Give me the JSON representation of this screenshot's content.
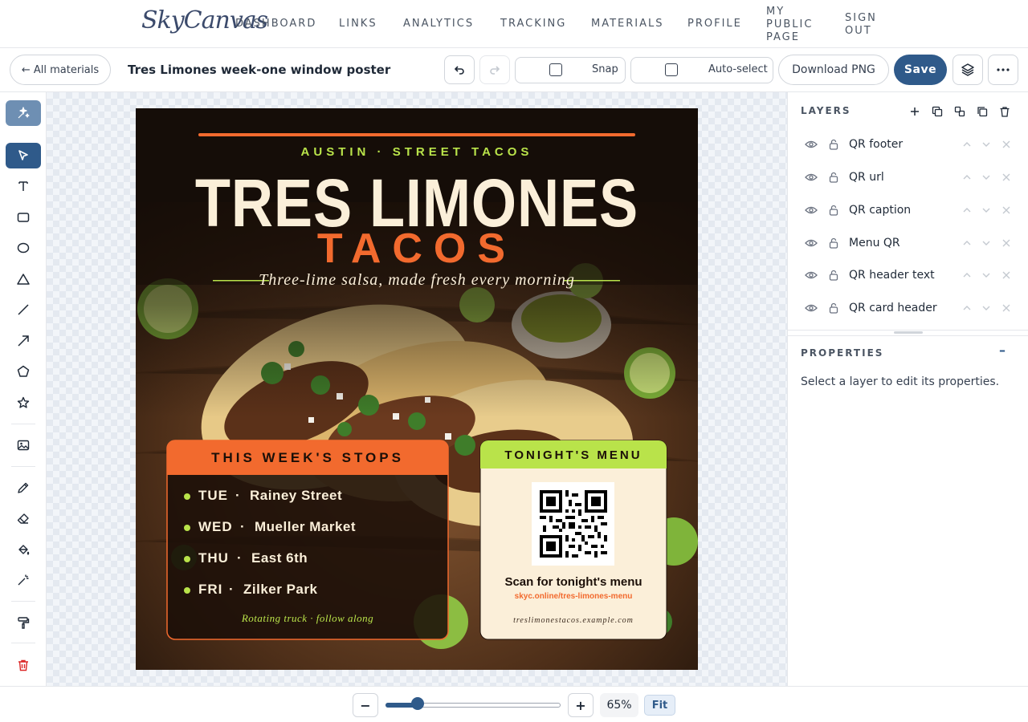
{
  "app": {
    "logo": "SkyCanvas"
  },
  "nav": {
    "dashboard": "DASHBOARD",
    "links": "LINKS",
    "analytics": "ANALYTICS",
    "tracking": "TRACKING",
    "materials": "MATERIALS",
    "profile": "PROFILE",
    "public_1": "MY",
    "public_2": "PUBLIC",
    "public_3": "PAGE",
    "sign_1": "SIGN",
    "sign_2": "OUT"
  },
  "toolbar": {
    "back": "← All materials",
    "title": "Tres Limones week-one window poster",
    "snap": "Snap",
    "autoselect": "Auto-select",
    "download": "Download PNG",
    "save": "Save"
  },
  "poster": {
    "kicker": "AUSTIN · STREET TACOS",
    "title": "TRES LIMONES",
    "subtitle": "TACOS",
    "tagline": "Three-lime salsa, made fresh every morning",
    "stops_header": "THIS WEEK'S STOPS",
    "stops": [
      {
        "day": "TUE",
        "place": "Rainey Street"
      },
      {
        "day": "WED",
        "place": "Mueller Market"
      },
      {
        "day": "THU",
        "place": "East 6th"
      },
      {
        "day": "FRI",
        "place": "Zilker Park"
      }
    ],
    "stops_sep": "·",
    "stops_footer": "Rotating truck · follow along",
    "menu_header": "TONIGHT'S MENU",
    "qr_caption": "Scan for tonight's menu",
    "qr_url": "skyc.online/tres-limones-menu",
    "qr_footer": "treslimonestacos.example.com"
  },
  "layers": {
    "title": "LAYERS",
    "items": [
      {
        "name": "QR footer"
      },
      {
        "name": "QR url"
      },
      {
        "name": "QR caption"
      },
      {
        "name": "Menu QR"
      },
      {
        "name": "QR header text"
      },
      {
        "name": "QR card header"
      }
    ]
  },
  "properties": {
    "title": "PROPERTIES",
    "empty": "Select a layer to edit its properties.",
    "collapse": "–"
  },
  "zoom": {
    "minus": "−",
    "plus": "+",
    "value": "65%",
    "fit": "Fit",
    "fraction": 0.16
  },
  "colors": {
    "accent": "#2f5a8a",
    "poster_orange": "#f26a2e",
    "poster_lime": "#b9e34a",
    "poster_cream": "#fbefd9",
    "danger": "#dc2626"
  }
}
